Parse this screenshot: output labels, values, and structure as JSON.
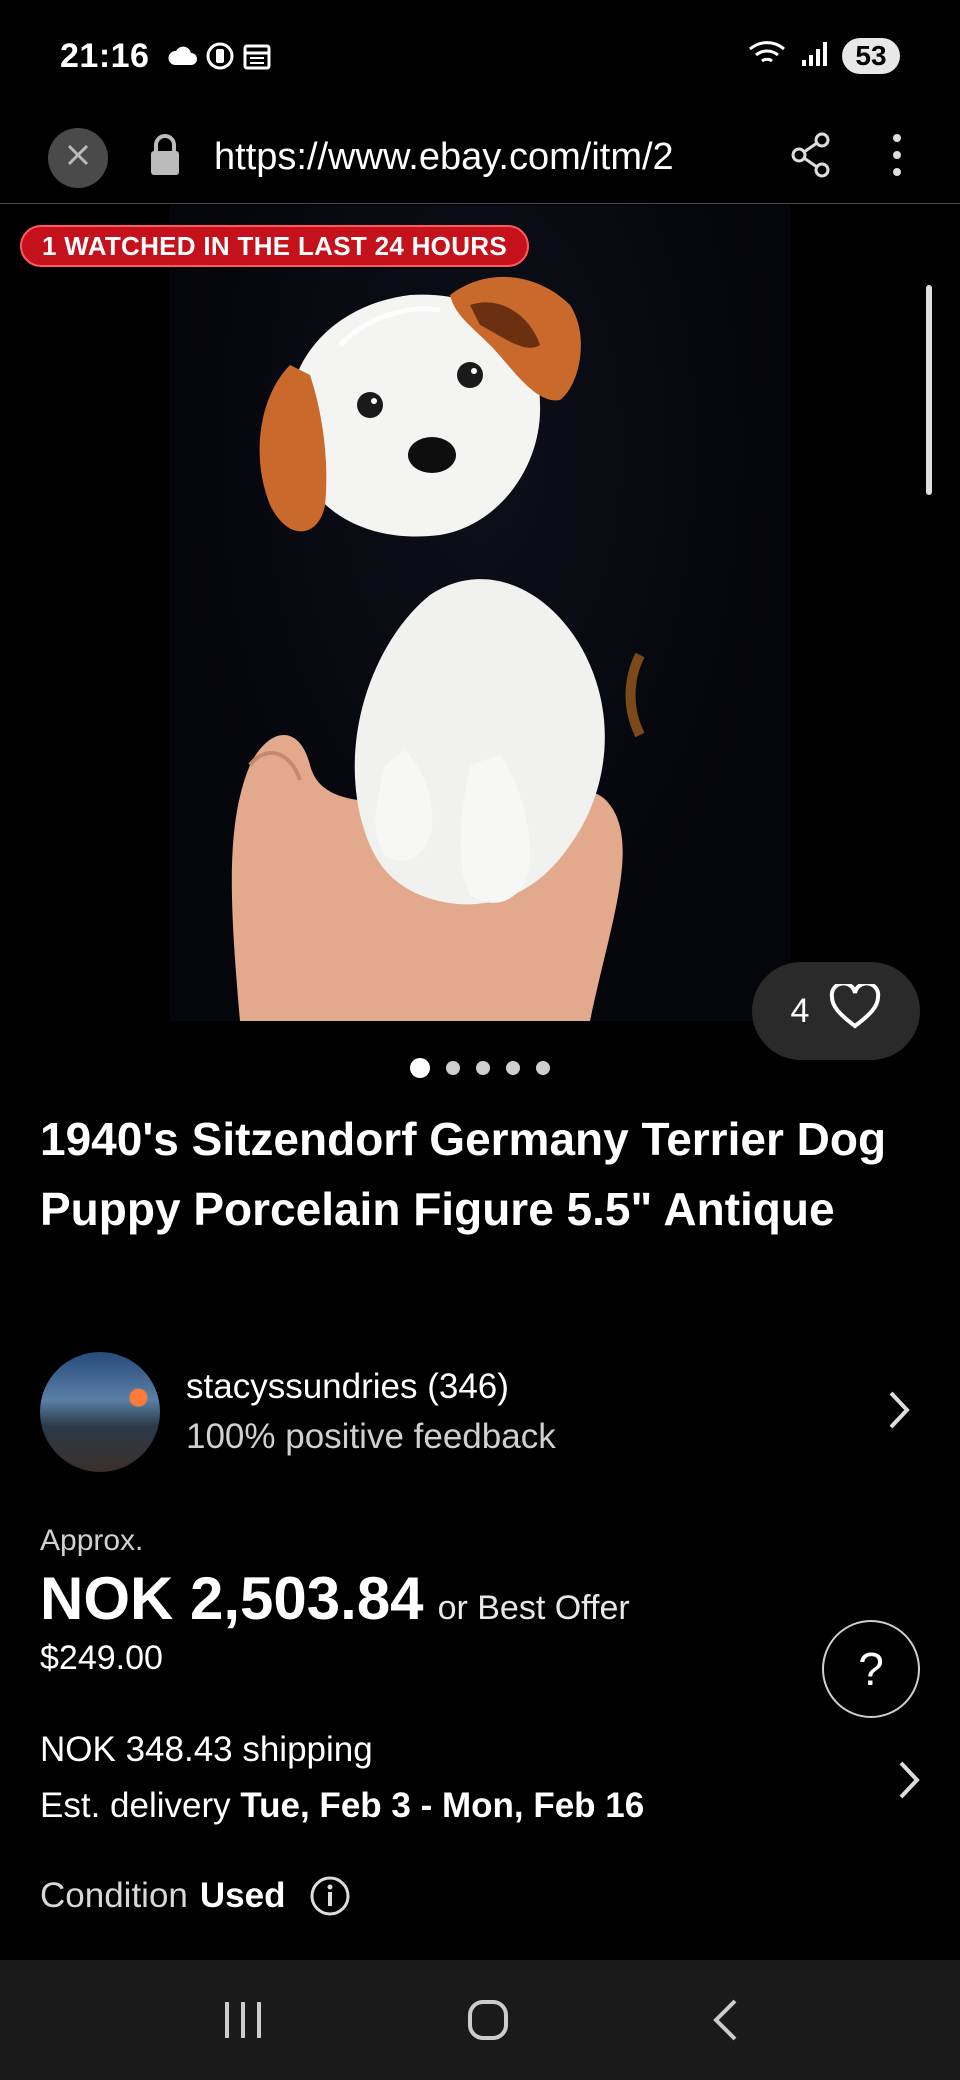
{
  "status_bar": {
    "time": "21:16",
    "battery": "53"
  },
  "browser": {
    "url": "https://www.ebay.com/itm/2"
  },
  "gallery": {
    "watched_badge": "1 WATCHED IN THE LAST 24 HOURS",
    "like_count": "4",
    "image_count": 5,
    "current_image": 1
  },
  "listing": {
    "title": "1940's Sitzendorf Germany Terrier Dog Puppy Porcelain Figure 5.5\" Antique",
    "seller_name": "stacyssundries (346)",
    "seller_feedback": "100% positive feedback",
    "approx_label": "Approx.",
    "price": "NOK 2,503.84",
    "best_offer": "or Best Offer",
    "price_usd": "$249.00",
    "shipping": "NOK 348.43 shipping",
    "delivery_label": "Est. delivery",
    "delivery_dates": "Tue, Feb 3 - Mon, Feb 16",
    "condition_label": "Condition",
    "condition_value": "Used",
    "help_label": "?"
  },
  "colors": {
    "badge_red": "#c4111b",
    "background": "#000000"
  }
}
